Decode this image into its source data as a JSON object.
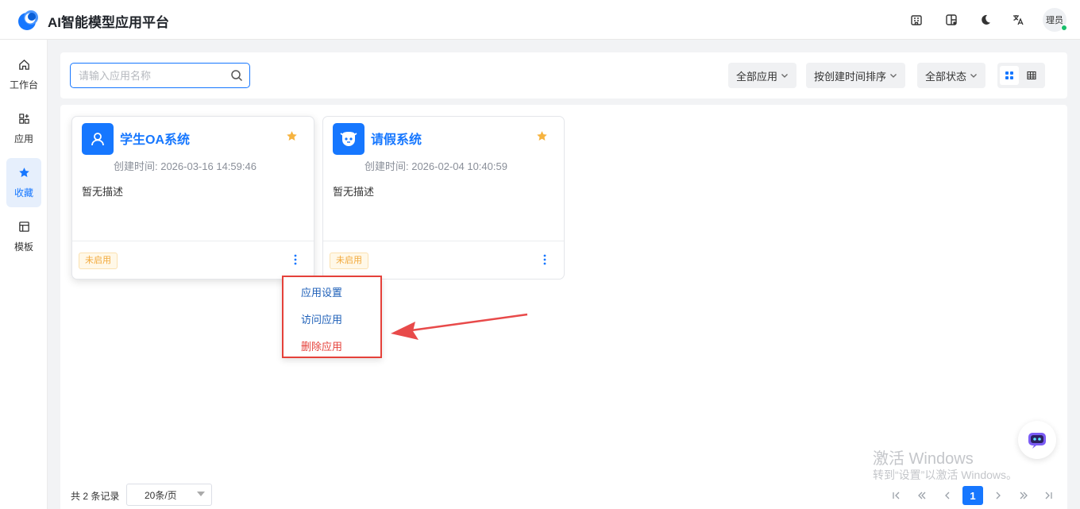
{
  "header": {
    "title": "AI智能模型应用平台",
    "avatar_text": "理员",
    "icons": [
      "building-icon",
      "layout-icon",
      "moon-icon",
      "translate-icon"
    ]
  },
  "sidebar": {
    "items": [
      {
        "label": "工作台",
        "icon": "home-icon",
        "active": false
      },
      {
        "label": "应用",
        "icon": "apps-icon",
        "active": false
      },
      {
        "label": "收藏",
        "icon": "star-icon",
        "active": true
      },
      {
        "label": "模板",
        "icon": "template-icon",
        "active": false
      }
    ]
  },
  "toolbar": {
    "search_placeholder": "请输入应用名称",
    "filter_all_apps": "全部应用",
    "sort_by": "按创建时间排序",
    "filter_status": "全部状态"
  },
  "cards": [
    {
      "name": "学生OA系统",
      "created": "创建时间: 2026-03-16 14:59:46",
      "description": "暂无描述",
      "status": "未启用",
      "icon": "user-icon",
      "favorited": true
    },
    {
      "name": "请假系统",
      "created": "创建时间: 2026-02-04 10:40:59",
      "description": "暂无描述",
      "status": "未启用",
      "icon": "bot-face-icon",
      "favorited": true
    }
  ],
  "menu": {
    "settings": "应用设置",
    "visit": "访问应用",
    "delete": "删除应用"
  },
  "footer": {
    "total": "共 2 条记录",
    "page_size": "20条/页",
    "current_page": "1"
  },
  "watermark": {
    "line1": "激活 Windows",
    "line2": "转到“设置”以激活 Windows。"
  },
  "colors": {
    "accent": "#1677ff",
    "danger": "#e5413a",
    "star": "#f6b33f",
    "badge_text": "#f2a93b"
  }
}
